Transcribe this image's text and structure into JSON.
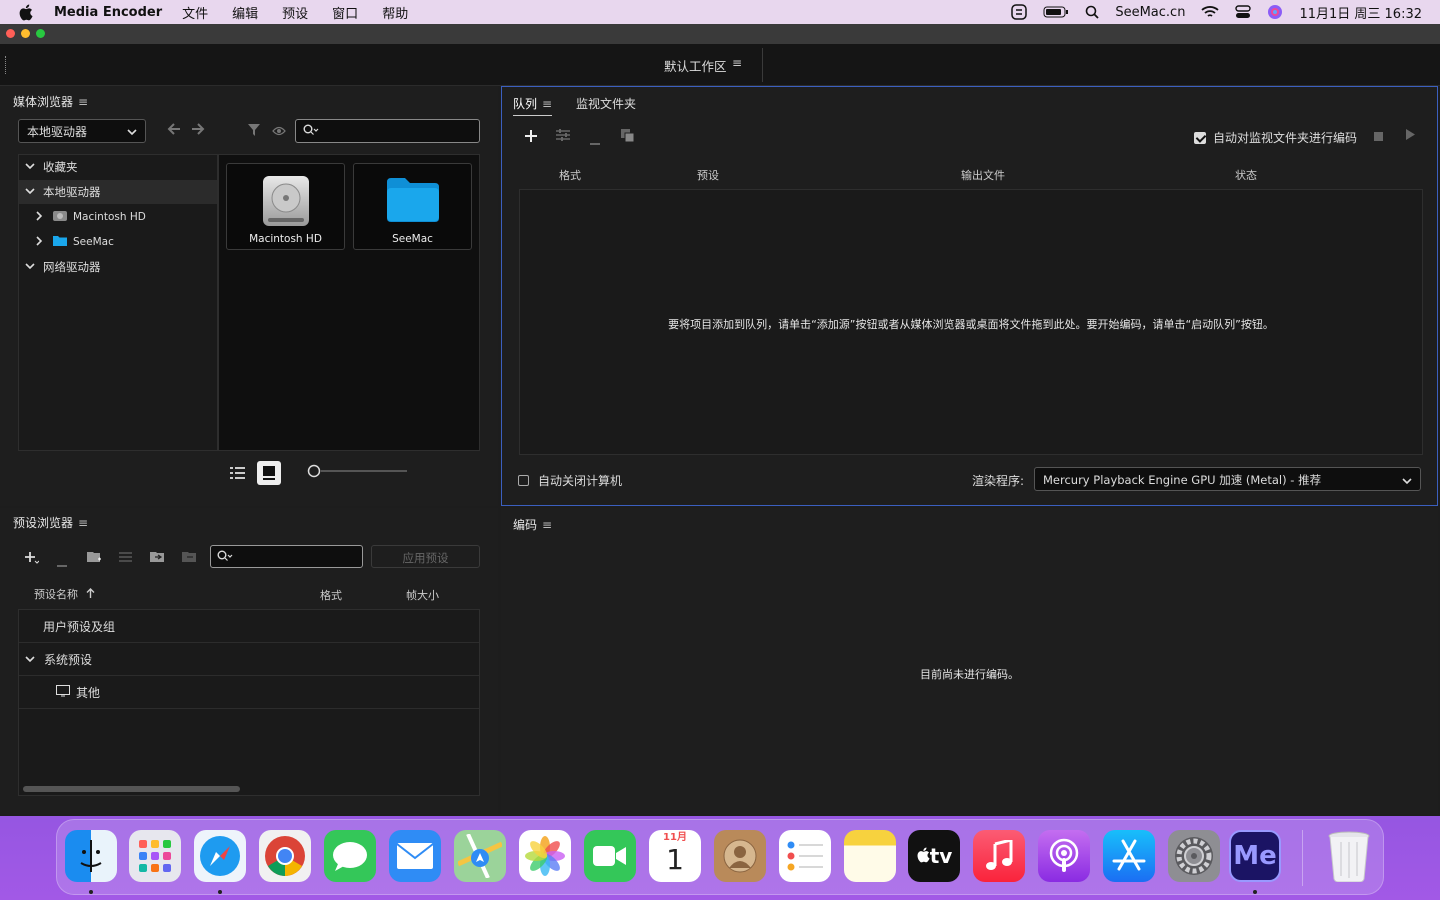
{
  "menubar": {
    "app_name": "Media Encoder",
    "menus": [
      "文件",
      "编辑",
      "预设",
      "窗口",
      "帮助"
    ],
    "site": "SeeMac.cn",
    "datetime": "11月1日 周三  16:32"
  },
  "workspace": {
    "label": "默认工作区"
  },
  "media_browser": {
    "title": "媒体浏览器",
    "drive_select": "本地驱动器",
    "tree": [
      {
        "label": "收藏夹"
      },
      {
        "label": "本地驱动器"
      },
      {
        "label": "Macintosh HD"
      },
      {
        "label": "SeeMac"
      },
      {
        "label": "网络驱动器"
      }
    ],
    "tiles": [
      {
        "label": "Macintosh HD"
      },
      {
        "label": "SeeMac"
      }
    ]
  },
  "queue": {
    "tabs": [
      "队列",
      "监视文件夹"
    ],
    "auto_encode_label": "自动对监视文件夹进行编码",
    "columns": [
      "格式",
      "预设",
      "输出文件",
      "状态"
    ],
    "empty_message": "要将项目添加到队列，请单击“添加源”按钮或者从媒体浏览器或桌面将文件拖到此处。要开始编码，请单击“启动队列”按钮。",
    "auto_shutdown_label": "自动关闭计算机",
    "renderer_label": "渲染程序:",
    "renderer_value": "Mercury Playback Engine GPU 加速 (Metal) - 推荐"
  },
  "preset_browser": {
    "title": "预设浏览器",
    "apply_label": "应用预设",
    "columns": [
      "预设名称",
      "格式",
      "帧大小"
    ],
    "rows": [
      {
        "label": "用户预设及组"
      },
      {
        "label": "系统预设"
      },
      {
        "label": "其他"
      }
    ]
  },
  "encoding": {
    "title": "编码",
    "empty_message": "目前尚未进行编码。"
  },
  "dock": {
    "calendar_month": "11月",
    "calendar_day": "1",
    "tv_label": "tv",
    "me_label": "Me"
  },
  "colors": {
    "accent": "#3b5fbf",
    "folder_blue": "#1aa7ec"
  }
}
